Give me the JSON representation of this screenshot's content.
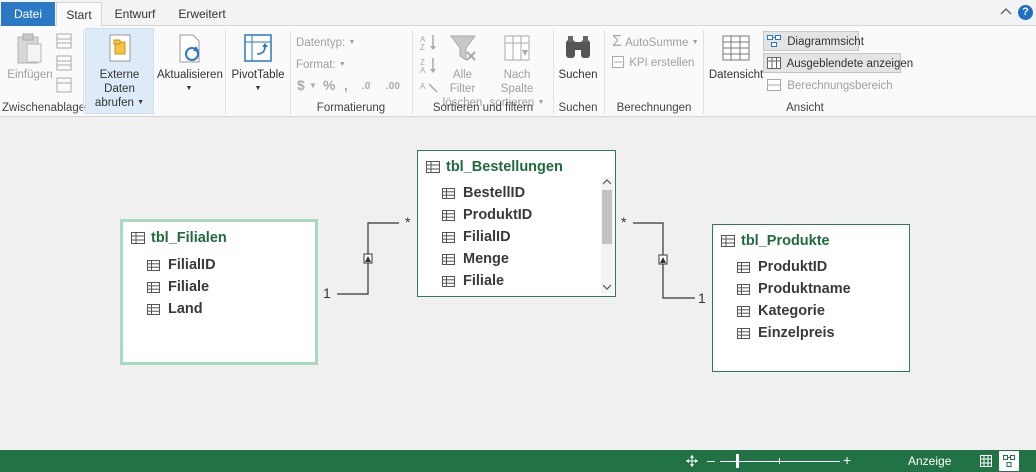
{
  "tabs": [
    "Datei",
    "Start",
    "Entwurf",
    "Erweitert"
  ],
  "help_label": "?",
  "ribbon": {
    "zwischenablage": {
      "einfuegen": "Einfügen",
      "group": "Zwischenablage"
    },
    "externe": {
      "line1": "Externe Daten",
      "line2": "abrufen"
    },
    "aktualisieren": "Aktualisieren",
    "pivot": "PivotTable",
    "formatierung": {
      "datentyp": "Datentyp:",
      "format": "Format:",
      "group": "Formatierung"
    },
    "sortieren": {
      "filter1": "Alle Filter",
      "filter2": "löschen",
      "sort1": "Nach Spalte",
      "sort2": "sortieren",
      "group": "Sortieren und filtern"
    },
    "suchen": {
      "button": "Suchen",
      "group": "Suchen"
    },
    "berechnungen": {
      "autosumme": "AutoSumme",
      "kpi": "KPI erstellen",
      "group": "Berechnungen"
    },
    "ansicht": {
      "datensicht": "Datensicht",
      "diagrammsicht": "Diagrammsicht",
      "ausgeblendete": "Ausgeblendete anzeigen",
      "berechnungsbereich": "Berechnungsbereich",
      "group": "Ansicht"
    }
  },
  "tables": {
    "filialen": {
      "name": "tbl_Filialen",
      "fields": [
        "FilialID",
        "Filiale",
        "Land"
      ]
    },
    "bestellungen": {
      "name": "tbl_Bestellungen",
      "fields": [
        "BestellID",
        "ProduktID",
        "FilialID",
        "Menge",
        "Filiale"
      ]
    },
    "produkte": {
      "name": "tbl_Produkte",
      "fields": [
        "ProduktID",
        "Produktname",
        "Kategorie",
        "Einzelpreis"
      ]
    }
  },
  "relationships": {
    "filialen": {
      "one": "1",
      "many": "*"
    },
    "produkte": {
      "one": "1",
      "many": "*"
    }
  },
  "status": {
    "anzeige": "Anzeige",
    "zoom_minus": "–",
    "zoom_plus": "+"
  }
}
